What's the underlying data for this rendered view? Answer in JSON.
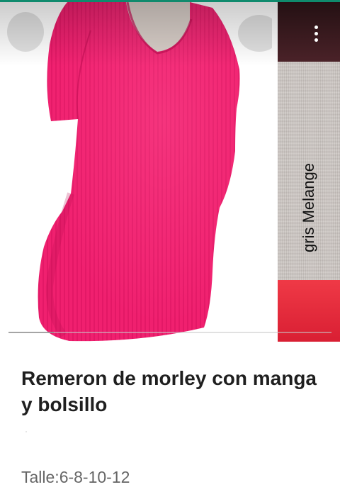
{
  "colors": {
    "top_accent": "#0f8a6d",
    "shirt_pink": "#f0206f",
    "swatch_dark": "#2e1418",
    "swatch_gray": "#cbc5c1",
    "swatch_red": "#e62a3d"
  },
  "gallery": {
    "main_image": "pink-ribbed-tshirt-photo",
    "side_image": "fabric-color-swatches",
    "side_caption": "gris Melange",
    "menu_icon": "more-vert-icon"
  },
  "product": {
    "title": "Remeron de morley con manga y bolsillo",
    "sizes": "Talle:6-8-10-12"
  }
}
